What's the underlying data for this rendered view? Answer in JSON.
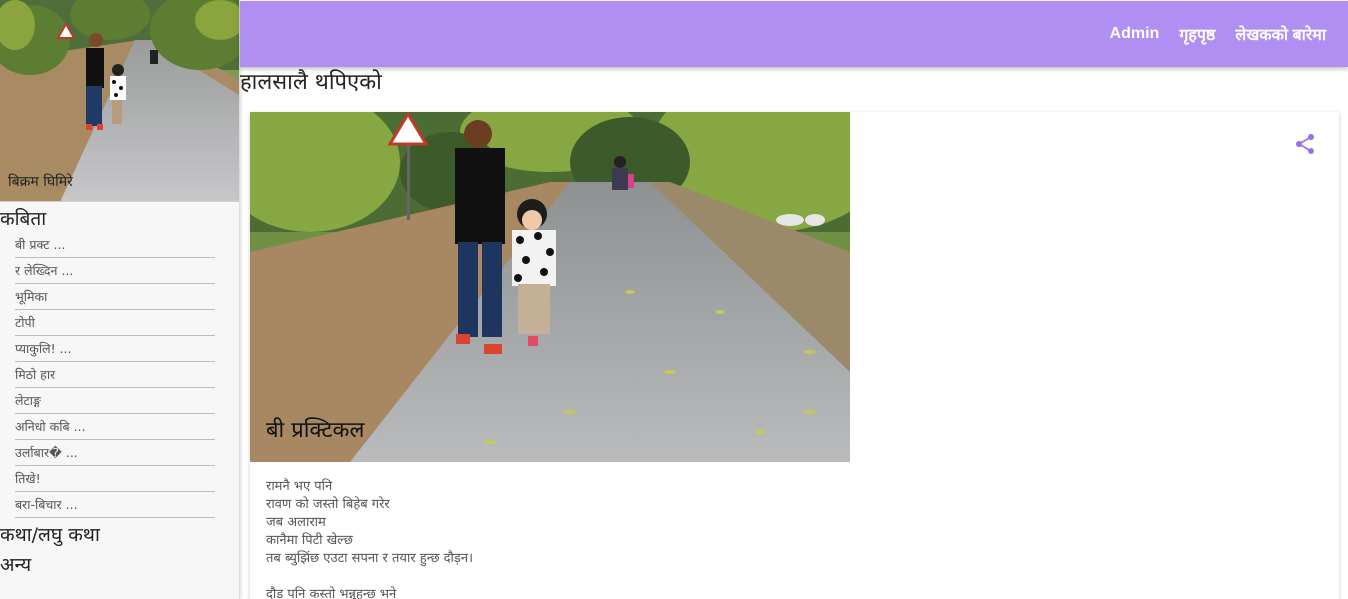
{
  "header": {
    "nav": [
      "Admin",
      "गृहपृष्ठ",
      "लेखकको बारेमा"
    ]
  },
  "sidebar": {
    "author_name": "बिक्रम घिमिरे",
    "sections": [
      {
        "title": "कबिता",
        "items": [
          "बी प्रक्ट ...",
          "र लेख्दिन ...",
          "भूमिका",
          "टोपी",
          "प्याकुलि! ...",
          "मिठो हार",
          "लेटाङ्ग",
          "अनिधो कबि ...",
          "उर्लाबार� ...",
          "तिखे!",
          "बरा-बिचार ..."
        ]
      },
      {
        "title": "कथा/लघु कथा"
      },
      {
        "title": "अन्य"
      }
    ]
  },
  "main": {
    "heading": "हालसालै थपिएको",
    "post": {
      "title": "बी प्रक्टिकल",
      "lines": [
        "रामनै भए पनि",
        "रावण को जस्तो बिहेब गरेर",
        "जब अलाराम",
        "कानैमा पिटी खेल्छ",
        "तब ब्युझिंछ एउटा सपना र तयार हुन्छ दौड़न।",
        "",
        "दौड पनि कस्तो भन्नुहुन्छ भने"
      ]
    }
  },
  "colors": {
    "topbar": "#b18ef2",
    "accent": "#9c6ee8"
  },
  "icons": {
    "share": "share-icon"
  }
}
